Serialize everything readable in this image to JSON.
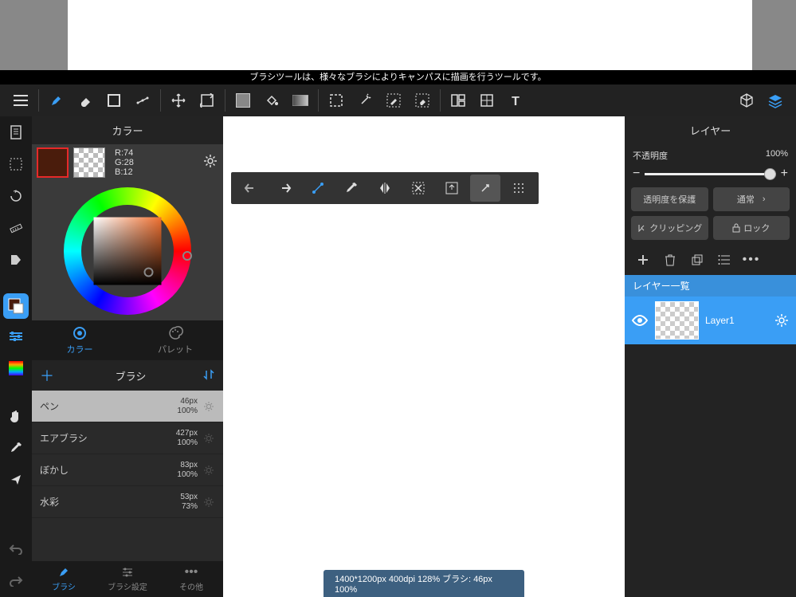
{
  "banner": "ブラシツールは、様々なブラシによりキャンパスに描画を行うツールです。",
  "color_panel": {
    "title": "カラー",
    "rgb": {
      "r": "R:74",
      "g": "G:28",
      "b": "B:12"
    },
    "tabs": {
      "color": "カラー",
      "palette": "パレット"
    }
  },
  "brush_panel": {
    "title": "ブラシ",
    "items": [
      {
        "name": "ペン",
        "size": "46px",
        "opacity": "100%"
      },
      {
        "name": "エアブラシ",
        "size": "427px",
        "opacity": "100%"
      },
      {
        "name": "ぼかし",
        "size": "83px",
        "opacity": "100%"
      },
      {
        "name": "水彩",
        "size": "53px",
        "opacity": "73%"
      }
    ],
    "bottom": {
      "brush": "ブラシ",
      "settings": "ブラシ設定",
      "other": "その他"
    }
  },
  "layer_panel": {
    "title": "レイヤー",
    "opacity_label": "不透明度",
    "opacity_value": "100%",
    "protect": "透明度を保護",
    "blend": "通常",
    "clipping": "クリッピング",
    "lock": "ロック",
    "list_header": "レイヤー一覧",
    "layers": [
      {
        "name": "Layer1"
      }
    ]
  },
  "status": "1400*1200px 400dpi 128% ブラシ: 46px 100%"
}
